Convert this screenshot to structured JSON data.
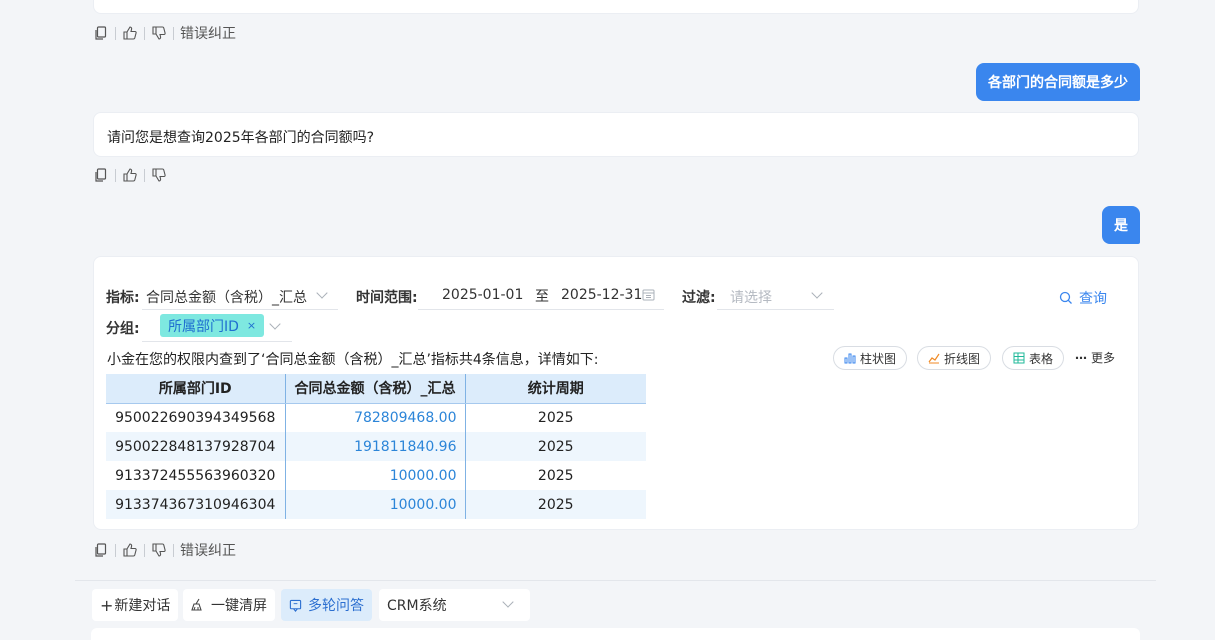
{
  "messages": {
    "user_question_1": "各部门的合同额是多少",
    "assistant_clarify": "请问您是想查询2025年各部门的合同额吗?",
    "user_confirm": "是"
  },
  "actions": {
    "copy_icon": "copy-icon",
    "like_icon": "thumbs-up-icon",
    "dislike_icon": "thumbs-down-icon",
    "correct_label": "错误纠正"
  },
  "filters": {
    "metric_label": "指标:",
    "metric_value": "合同总金额（含税）_汇总",
    "time_label": "时间范围:",
    "start_date": "2025-01-01",
    "to_label": "至",
    "end_date": "2025-12-31",
    "filter_label": "过滤:",
    "filter_placeholder": "请选择",
    "group_label": "分组:",
    "group_tag": "所属部门ID",
    "tag_remove": "×",
    "query_label": "查询"
  },
  "result": {
    "summary": "小金在您的权限内查到了‘合同总金额（含税）_汇总’指标共4条信息，详情如下:",
    "views": {
      "bar": "柱状图",
      "line": "折线图",
      "table": "表格",
      "more": "更多",
      "more_icon": "⋯"
    },
    "columns": [
      "所属部门ID",
      "合同总金额（含税）_汇总",
      "统计周期"
    ],
    "rows": [
      [
        "950022690394349568",
        "782809468.00",
        "2025"
      ],
      [
        "950022848137928704",
        "191811840.96",
        "2025"
      ],
      [
        "913372455563960320",
        "10000.00",
        "2025"
      ],
      [
        "913374367310946304",
        "10000.00",
        "2025"
      ]
    ]
  },
  "bottom": {
    "new_chat": "新建对话",
    "new_chat_icon": "+",
    "clear": "一键清屏",
    "multi_turn": "多轮问答",
    "system_select": "CRM系统"
  },
  "colors": {
    "accent": "#3a86ee",
    "tag_bg": "#7ee8e0",
    "table_header": "#dcecfb",
    "link_value": "#2c85d8"
  }
}
